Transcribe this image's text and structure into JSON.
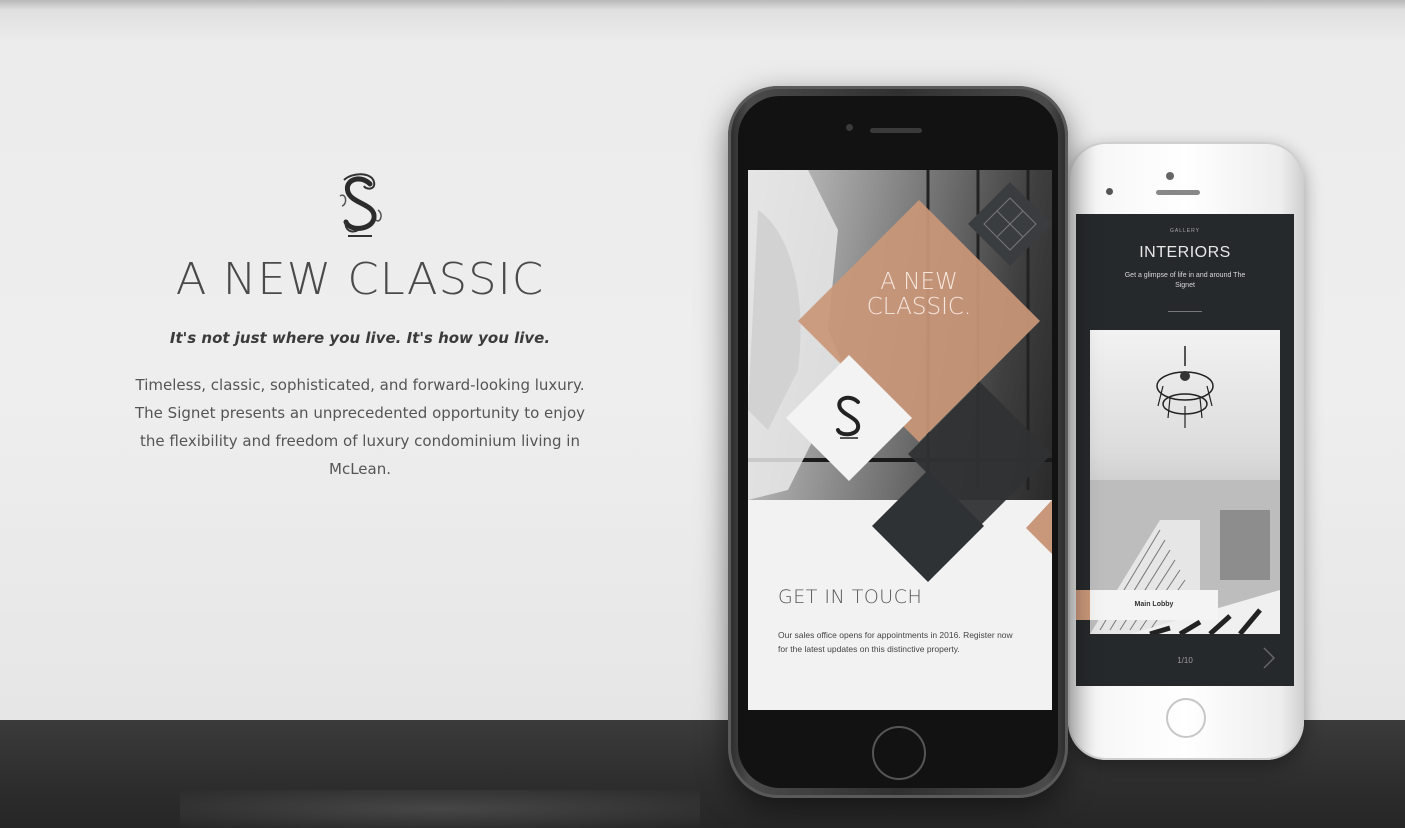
{
  "hero": {
    "headline": "A NEW CLASSIC",
    "tagline": "It's not just where you live. It's how you live.",
    "body": "Timeless, classic, sophisticated, and forward-looking luxury. The Signet presents an unprecedented opportunity to enjoy the flexibility and freedom of luxury condominium living in McLean.",
    "logo_icon": "signet-s-monogram-icon"
  },
  "front_phone": {
    "hero_text": "A NEW CLASSIC.",
    "contact_title": "GET IN TOUCH",
    "contact_body": "Our sales office opens for appointments in 2016. Register now for the latest updates on this distinctive property.",
    "accent_color": "#c99779"
  },
  "back_phone": {
    "kicker": "GALLERY",
    "title": "INTERIORS",
    "subtitle": "Get a glimpse of life in and around The Signet",
    "caption": "Main Lobby",
    "counter": "1/10",
    "next_icon": "chevron-right-icon"
  },
  "colors": {
    "background": "#ececec",
    "floor": "#2f2f2f",
    "accent": "#c99779",
    "dark_panel": "#26292b"
  }
}
